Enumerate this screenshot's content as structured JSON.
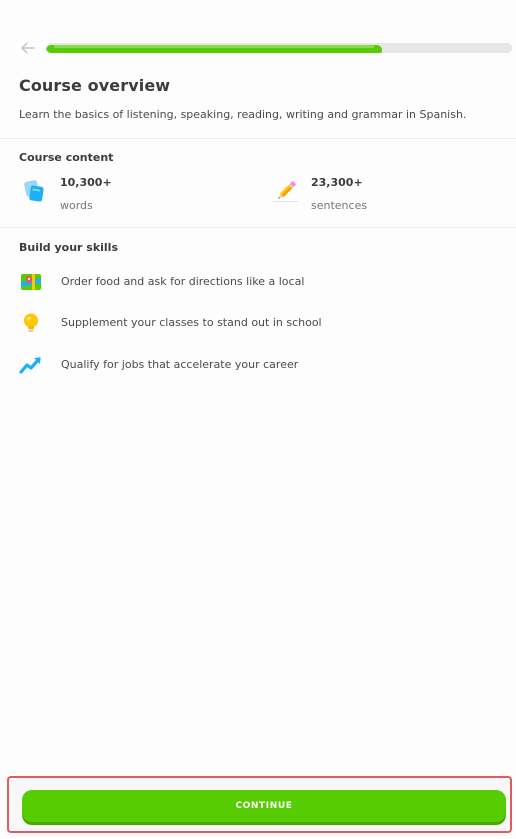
{
  "header": {
    "progress_fraction": 0.72
  },
  "overview": {
    "title": "Course overview",
    "description": "Learn the basics of listening, speaking, reading, writing and grammar in Spanish."
  },
  "course_content": {
    "heading": "Course content",
    "stats": [
      {
        "value": "10,300+",
        "unit": "words",
        "icon": "flashcards-icon"
      },
      {
        "value": "23,300+",
        "unit": "sentences",
        "icon": "pencil-icon"
      }
    ]
  },
  "skills": {
    "heading": "Build your skills",
    "items": [
      {
        "label": "Order food and ask for directions like a local",
        "icon": "map-icon"
      },
      {
        "label": "Supplement your classes to stand out in school",
        "icon": "lightbulb-icon"
      },
      {
        "label": "Qualify for jobs that accelerate your career",
        "icon": "trend-up-icon"
      }
    ]
  },
  "footer": {
    "continue_label": "CONTINUE"
  },
  "colors": {
    "accent": "#58cc02",
    "progress_track": "#e7e7e7",
    "highlight_border": "#e05a5e"
  }
}
